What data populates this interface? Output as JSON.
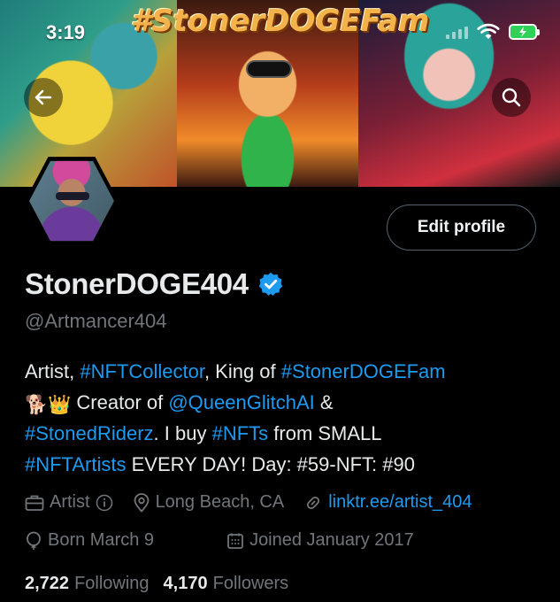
{
  "status_bar": {
    "time": "3:19"
  },
  "banner": {
    "hashtag": "#StonerDOGEFam"
  },
  "profile": {
    "edit_label": "Edit profile",
    "display_name": "StonerDOGE404",
    "handle": "@Artmancer404",
    "bio": {
      "l1_a": "Artist, ",
      "l1_tag1": "#NFTCollector",
      "l1_b": ", King of ",
      "l1_tag2": "#StonerDOGEFam",
      "l2_emoji": "🐕👑",
      "l2_a": " Creator of ",
      "l2_mention": "@QueenGlitchAI",
      "l2_b": " &",
      "l3_tag1": "#StonedRiderz",
      "l3_a": ". I buy ",
      "l3_tag2": "#NFTs",
      "l3_b": " from SMALL",
      "l4_tag": "#NFTArtists",
      "l4_a": " EVERY DAY! Day: #59-NFT: #90"
    },
    "category": "Artist",
    "location": "Long Beach, CA",
    "website": "linktr.ee/artist_404",
    "born": "Born March 9",
    "joined": "Joined January 2017",
    "following_count": "2,722",
    "following_label": "Following",
    "followers_count": "4,170",
    "followers_label": "Followers"
  },
  "colors": {
    "link": "#1d9bf0",
    "muted": "#71767b",
    "text": "#e7e9ea",
    "background": "#000000"
  },
  "icons": [
    "back-arrow-icon",
    "search-icon",
    "verified-badge-icon",
    "briefcase-icon",
    "info-icon",
    "location-pin-icon",
    "link-icon",
    "balloon-icon",
    "calendar-icon",
    "wifi-icon",
    "battery-icon",
    "signal-icon"
  ]
}
